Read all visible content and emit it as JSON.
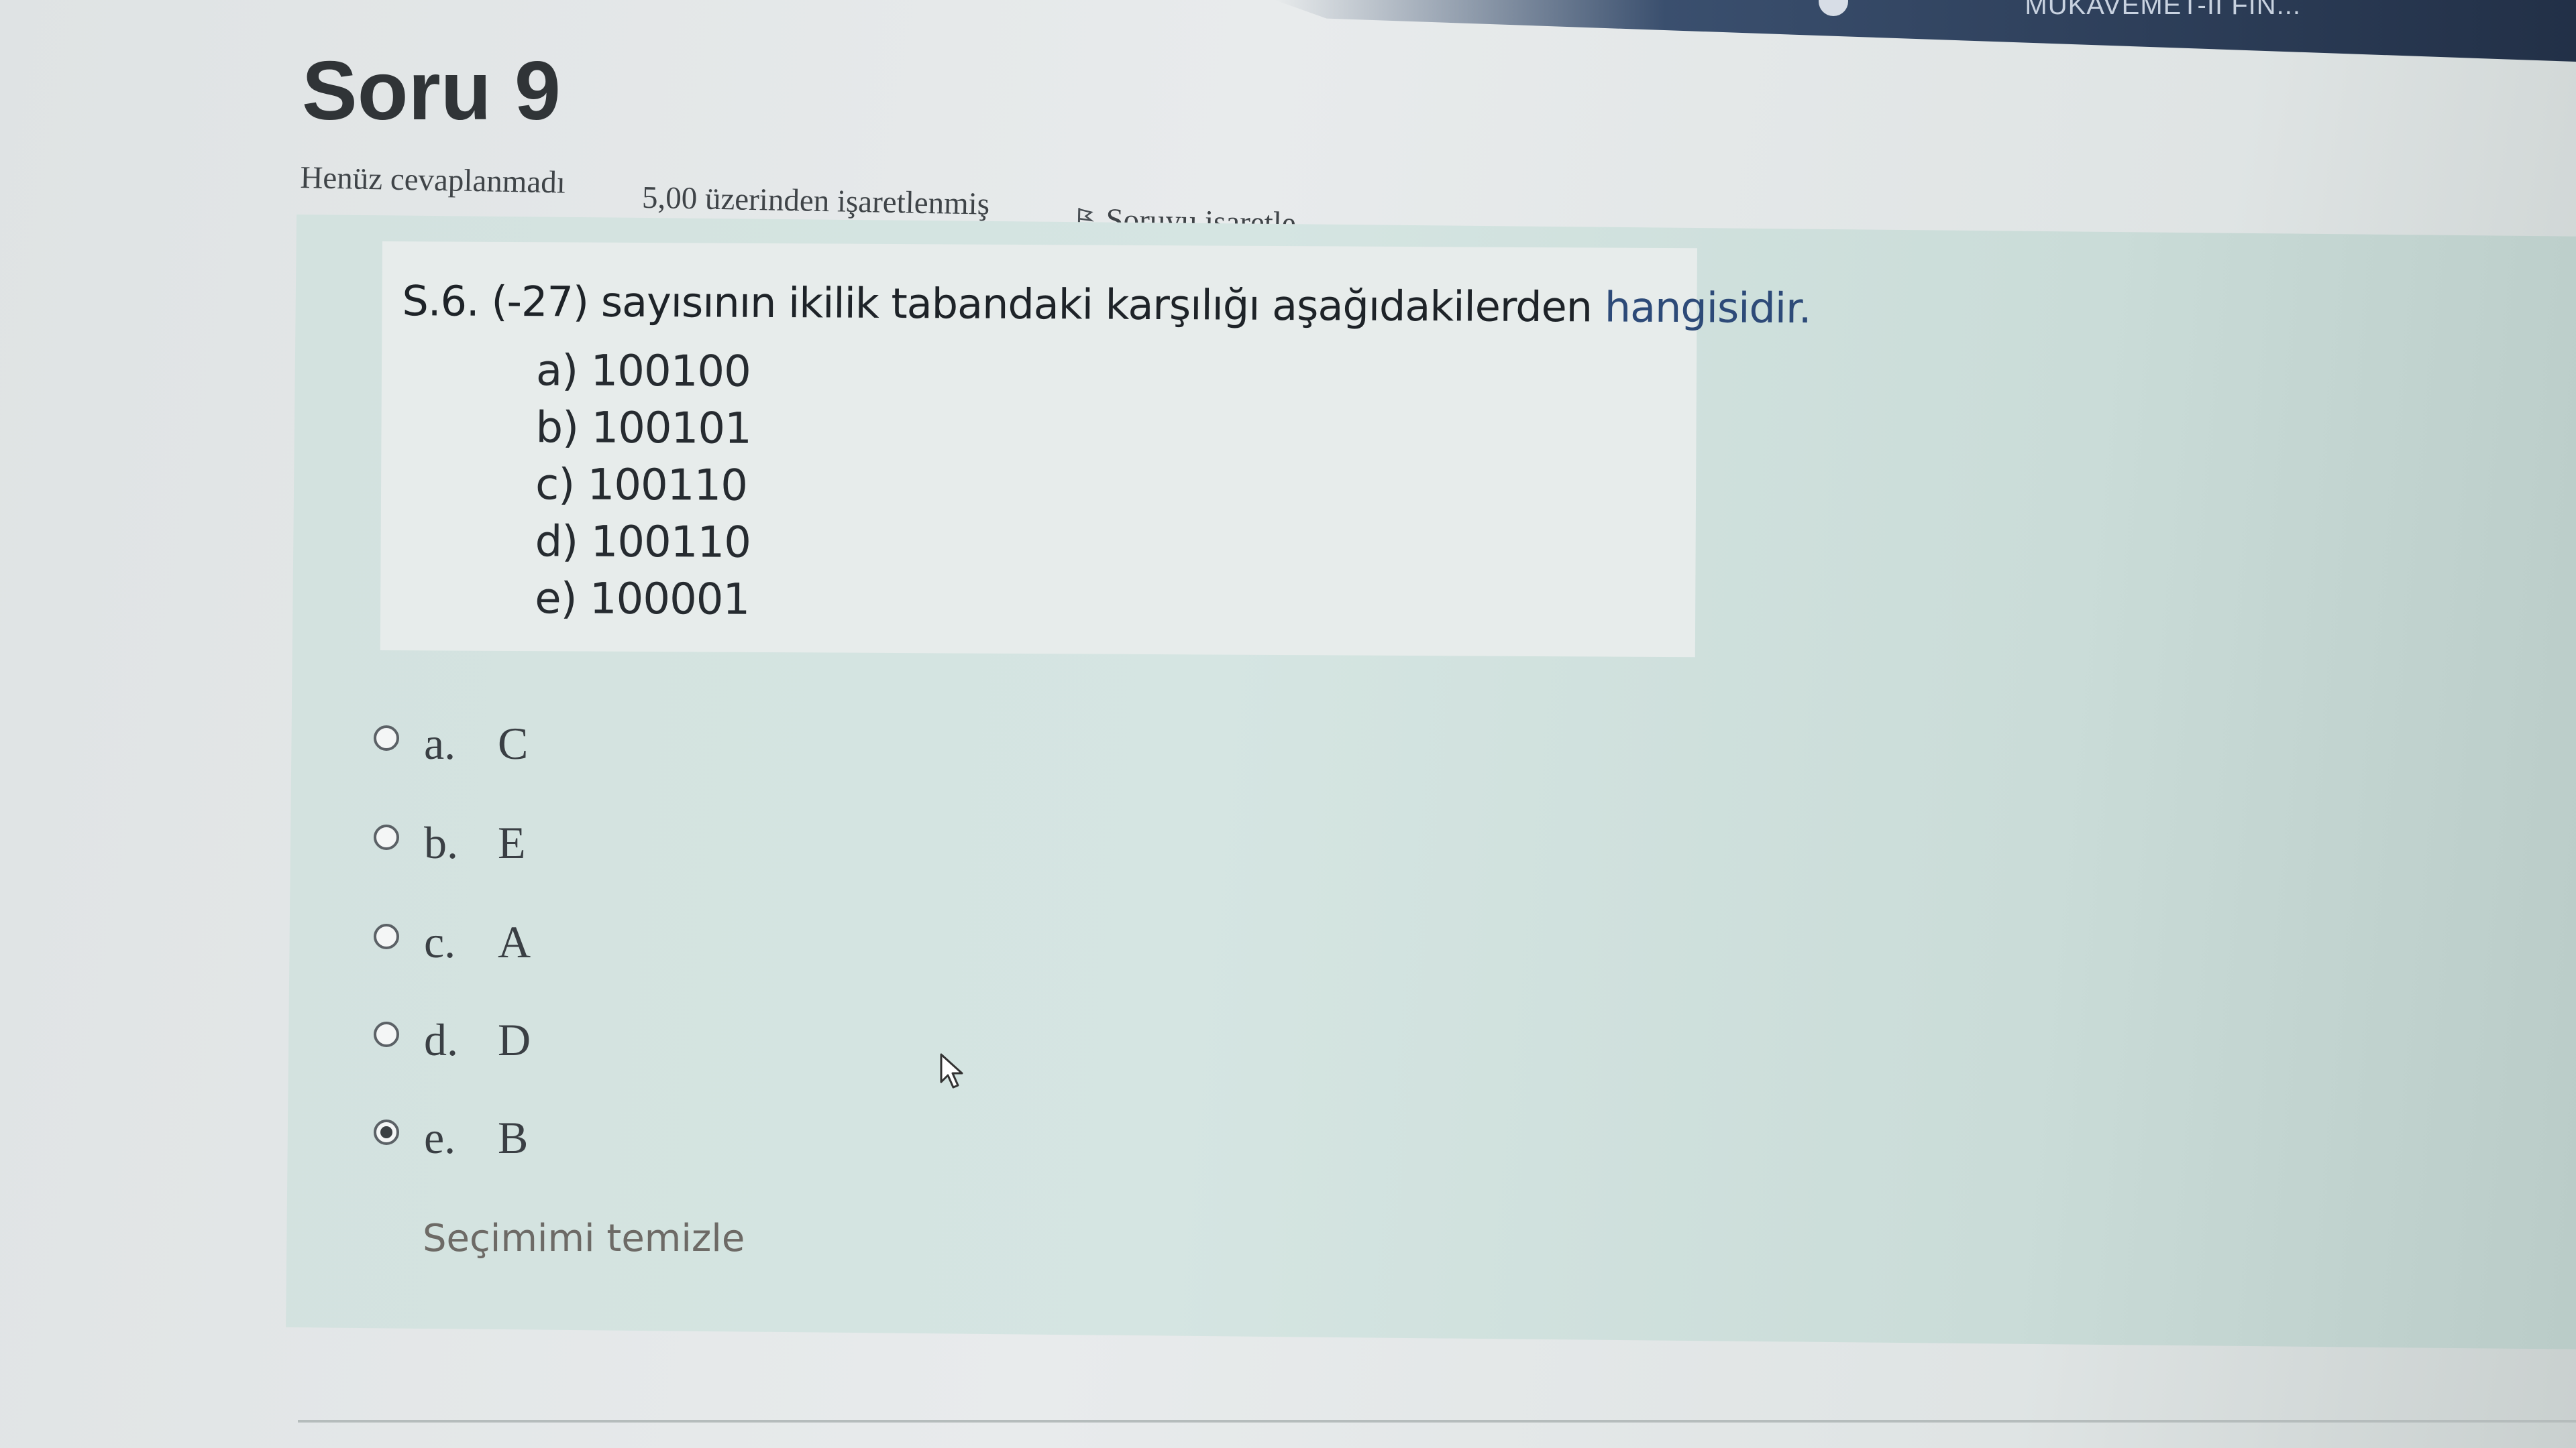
{
  "topbar": {
    "course_title": "MUKAVEMET-II FIN..."
  },
  "question": {
    "title": "Soru 9",
    "state": "Henüz cevaplanmadı",
    "grade": "5,00 üzerinden işaretlenmiş",
    "flag_label": "Soruyu işaretle"
  },
  "question_text": {
    "main": "S.6. (-27) sayısının ikilik tabandaki karşılığı aşağıdakilerden",
    "tail": "hangisidir.",
    "options": [
      "a) 100100",
      "b) 100101",
      "c) 100110",
      "d) 100110",
      "e) 100001"
    ]
  },
  "answers": [
    {
      "letter": "a.",
      "value": "C",
      "selected": false
    },
    {
      "letter": "b.",
      "value": "E",
      "selected": false
    },
    {
      "letter": "c.",
      "value": "A",
      "selected": false
    },
    {
      "letter": "d.",
      "value": "D",
      "selected": false
    },
    {
      "letter": "e.",
      "value": "B",
      "selected": true
    }
  ],
  "clear_choice": "Seçimimi temizle",
  "colors": {
    "panel": "#d3e2df",
    "accent_text": "#2d4a78",
    "topbar": "#223047"
  },
  "icons": {
    "flag": "flag-icon",
    "cursor": "mouse-pointer-icon",
    "user": "user-icon"
  }
}
